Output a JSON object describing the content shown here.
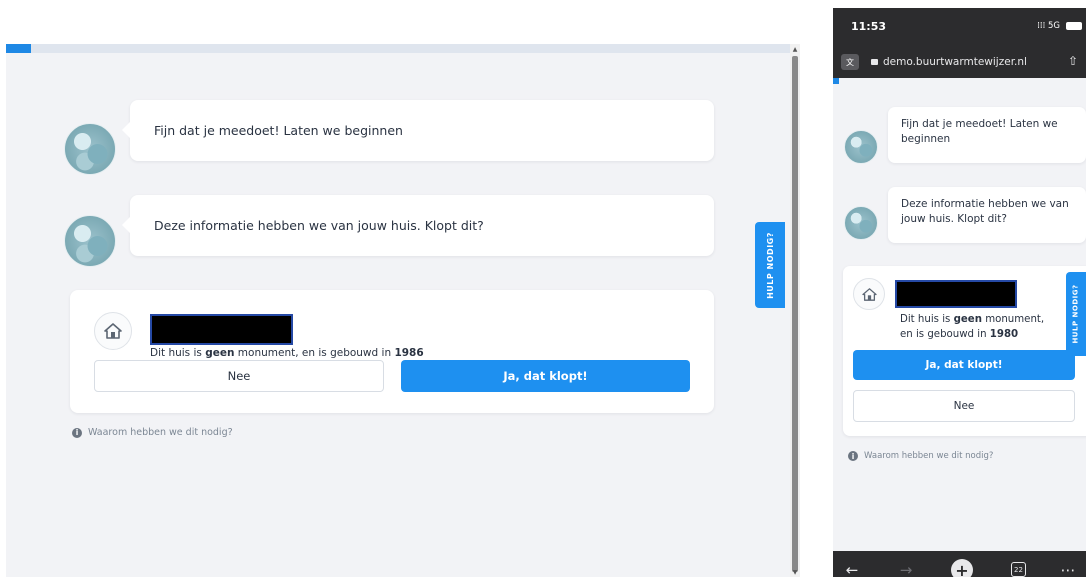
{
  "desktop": {
    "chat": [
      {
        "text": "Fijn dat je meedoet! Laten we beginnen"
      },
      {
        "text": "Deze informatie hebben we van jouw huis. Klopt dit?"
      }
    ],
    "card": {
      "info_prefix": "Dit huis is ",
      "info_bold": "geen",
      "info_mid": " monument, en is gebouwd in ",
      "info_year": "1986",
      "no_label": "Nee",
      "yes_label": "Ja, dat klopt!"
    },
    "why_label": "Waarom hebben we dit nodig?",
    "help_label": "HULP NODIG?"
  },
  "mobile": {
    "status": {
      "time": "11:53",
      "network": "5G"
    },
    "url": "demo.buurtwarmtewijzer.nl",
    "chat": [
      {
        "text": "Fijn dat je meedoet! Laten we beginnen"
      },
      {
        "text": "Deze informatie hebben we van jouw huis. Klopt dit?"
      }
    ],
    "card": {
      "info_prefix": "Dit huis is ",
      "info_bold": "geen",
      "info_mid": " monument, en is gebouwd in ",
      "info_year": "1980",
      "yes_label": "Ja, dat klopt!",
      "no_label": "Nee"
    },
    "why_label": "Waarom hebben we dit nodig?",
    "help_label": "HULP NODIG?",
    "toolbar": {
      "tabs_count": "22"
    }
  },
  "colors": {
    "accent": "#1e90f0",
    "background": "#f2f3f6",
    "redaction": "#000000"
  }
}
